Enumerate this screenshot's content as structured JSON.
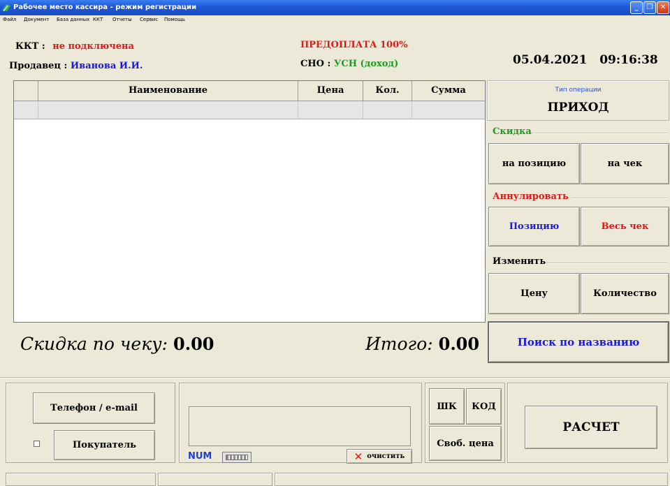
{
  "window": {
    "title": "Рабочее место кассира - режим регистрации"
  },
  "menu": [
    "Файл",
    "Документ",
    "База данных",
    "ККТ",
    "Отчеты",
    "Сервис",
    "Помощь"
  ],
  "info": {
    "kkt_label": "ККТ :",
    "kkt_status": "не подключена",
    "seller_label": "Продавец :",
    "seller_name": "Иванова И.И.",
    "prepay": "ПРЕДОПЛАТА 100%",
    "sno_label": "СНО :",
    "sno_value": "УСН (доход)",
    "datetime": "05.04.2021   09:16:38"
  },
  "table": {
    "columns": [
      "",
      "Наименование",
      "Цена",
      "Кол.",
      "Сумма"
    ],
    "rows": [
      [
        "",
        "",
        "",
        "",
        ""
      ]
    ]
  },
  "right_panel": {
    "operation_type_label": "Тип операции",
    "operation_type_value": "ПРИХОД",
    "discount_group": "Скидка",
    "discount_item": "на позицию",
    "discount_check": "на чек",
    "cancel_group": "Аннулировать",
    "cancel_item": "Позицию",
    "cancel_check": "Весь чек",
    "change_group": "Изменить",
    "change_price": "Цену",
    "change_qty": "Количество",
    "search": "Поиск по названию"
  },
  "totals": {
    "discount_label": "Скидка по чеку:",
    "discount_value": "0.00",
    "total_label": "Итого:",
    "total_value": "0.00"
  },
  "bottom": {
    "phone_email": "Телефон / e-mail",
    "buyer": "Покупатель",
    "num": "NUM",
    "clear": "очистить",
    "barcode": "ШК",
    "code": "КОД",
    "free_price": "Своб. цена",
    "pay": "РАСЧЕТ"
  },
  "colors": {
    "red": "#e01919",
    "blue": "#1a1adf",
    "green": "#1f9a1f",
    "face": "#ece9d8"
  }
}
